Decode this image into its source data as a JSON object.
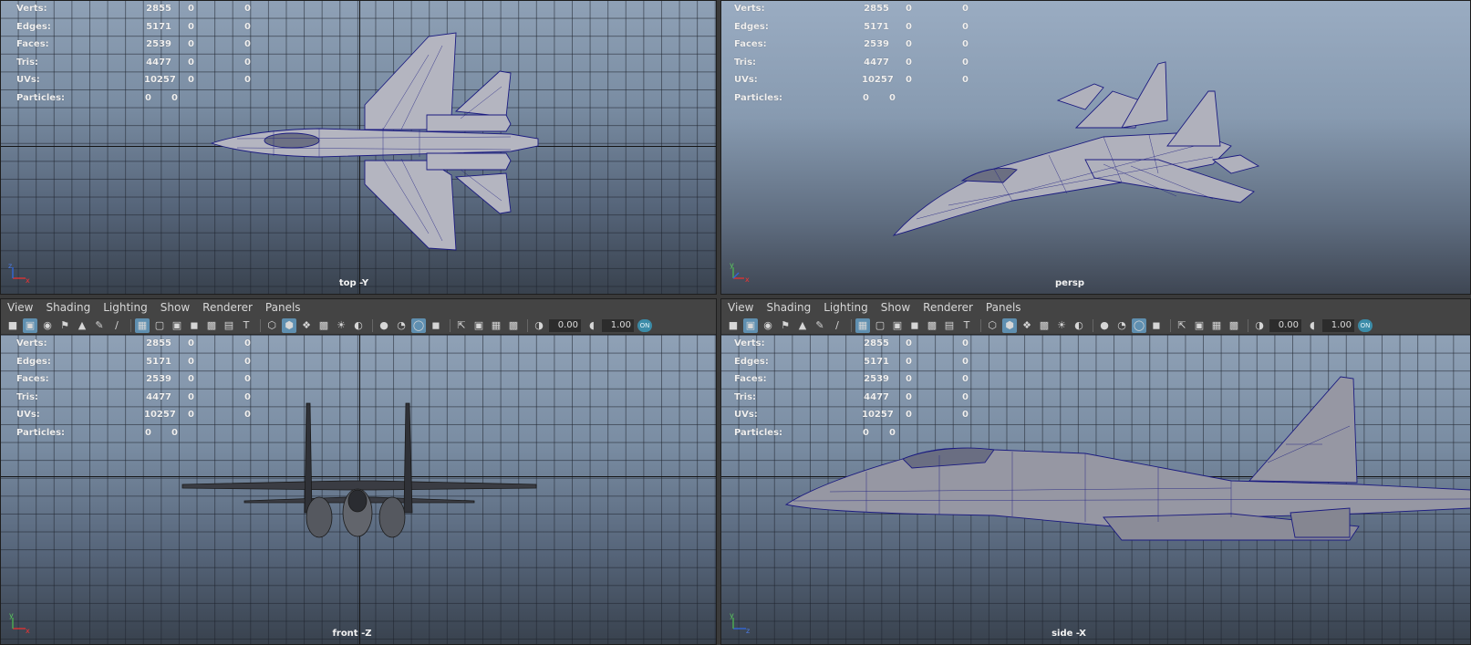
{
  "stats_labels": {
    "verts": "Verts:",
    "edges": "Edges:",
    "faces": "Faces:",
    "tris": "Tris:",
    "uvs": "UVs:",
    "particles": "Particles:"
  },
  "stats_values": {
    "verts": [
      "2855",
      "0",
      "0"
    ],
    "edges": [
      "5171",
      "0",
      "0"
    ],
    "faces": [
      "2539",
      "0",
      "0"
    ],
    "tris": [
      "4477",
      "0",
      "0"
    ],
    "uvs": [
      "10257",
      "0",
      "0"
    ],
    "particles": [
      "0",
      "0"
    ]
  },
  "viewports": {
    "top": {
      "camera_label": "top -Y"
    },
    "persp": {
      "camera_label": "persp"
    },
    "front": {
      "camera_label": "front -Z"
    },
    "side": {
      "camera_label": "side -X"
    }
  },
  "menu": {
    "view": "View",
    "shading": "Shading",
    "lighting": "Lighting",
    "show": "Show",
    "renderer": "Renderer",
    "panels": "Panels"
  },
  "toolbar": {
    "exposure_value": "0.00",
    "gamma_value": "1.00",
    "color_mgmt_label": "ON"
  },
  "axis_labels": {
    "x": "x",
    "y": "y",
    "z": "z"
  },
  "icons": [
    "camera-icon",
    "camera-lock-icon",
    "camera-attrs-icon",
    "bookmark-icon",
    "image-plane-icon",
    "grease-pencil-icon",
    "grid-icon",
    "film-gate-icon",
    "resolution-gate-icon",
    "gate-mask-icon",
    "field-chart-icon",
    "safe-action-icon",
    "title-safe-icon",
    "wireframe-icon",
    "smooth-shade-icon",
    "wireframe-on-shaded-icon",
    "textured-icon",
    "use-lights-icon",
    "shadows-icon",
    "screen-space-ao-icon",
    "motion-blur-icon",
    "anti-aliasing-icon",
    "depth-of-field-icon",
    "isolate-select-icon",
    "xray-icon",
    "xray-joints-icon",
    "xray-components-icon",
    "exposure-icon",
    "gamma-icon",
    "color-management-icon"
  ],
  "colors": {
    "viewport_top": "#8fa1b6",
    "viewport_bottom": "#38414d",
    "wire_color": "#1a1a7a",
    "mesh_fill": "#b7b7bf",
    "toolbar_bg": "#444444",
    "active_toggle": "#5f8fb0"
  }
}
